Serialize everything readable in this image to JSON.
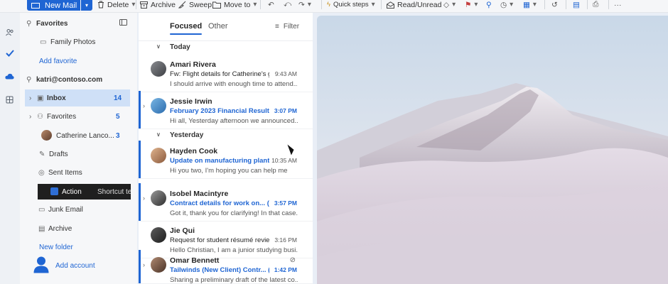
{
  "ribbon": {
    "new_mail": "New Mail",
    "delete": "Delete",
    "archive": "Archive",
    "sweep": "Sweep",
    "move_to": "Move to",
    "quick_steps": "Quick steps",
    "read_unread": "Read/Unread"
  },
  "folders": {
    "favorites_header": "Favorites",
    "family_photos": "Family Photos",
    "add_favorite": "Add favorite",
    "account": "katri@contoso.com",
    "inbox": "Inbox",
    "inbox_count": "14",
    "favorites": "Favorites",
    "favorites_count": "5",
    "catherine": "Catherine Lanco...",
    "catherine_count": "3",
    "drafts": "Drafts",
    "sent_items": "Sent Items",
    "action": "Action",
    "shortcut": "Shortcut te",
    "junk_email": "Junk Email",
    "archive": "Archive",
    "new_folder": "New folder",
    "add_account": "Add account"
  },
  "list": {
    "tab_focused": "Focused",
    "tab_other": "Other",
    "filter": "Filter",
    "group_today": "Today",
    "group_yesterday": "Yesterday",
    "messages": [
      {
        "from": "Amari Rivera",
        "subject": "Fw: Flight details for Catherine's gr...",
        "time": "9:43 AM",
        "preview": "I should arrive with enough time to attend..."
      },
      {
        "from": "Jessie Irwin",
        "subject": "February 2023 Financial Results",
        "time": "3:07 PM",
        "preview": "Hi all, Yesterday afternoon we announced..."
      },
      {
        "from": "Hayden Cook",
        "subject": "Update on manufacturing plant...",
        "time": "10:35 AM",
        "preview": "Hi you two, I'm hoping you can help me"
      },
      {
        "from": "Isobel Macintyre",
        "subject": "Contract details for work on... (3)",
        "time": "3:57 PM",
        "preview": "Got it, thank you for clarifying! In that case..."
      },
      {
        "from": "Jie Qui",
        "subject": "Request for student résumé review",
        "time": "3:16 PM",
        "preview": "Hello Christian, I am a junior studying busi..."
      },
      {
        "from": "Omar Bennett",
        "subject": "Tailwinds (New Client) Contr... (6)",
        "time": "1:42 PM",
        "preview": "Sharing a preliminary draft of the latest co..."
      }
    ]
  },
  "colors": {
    "accent": "#1f65d3",
    "selected_folder": "#cfe0f7"
  }
}
